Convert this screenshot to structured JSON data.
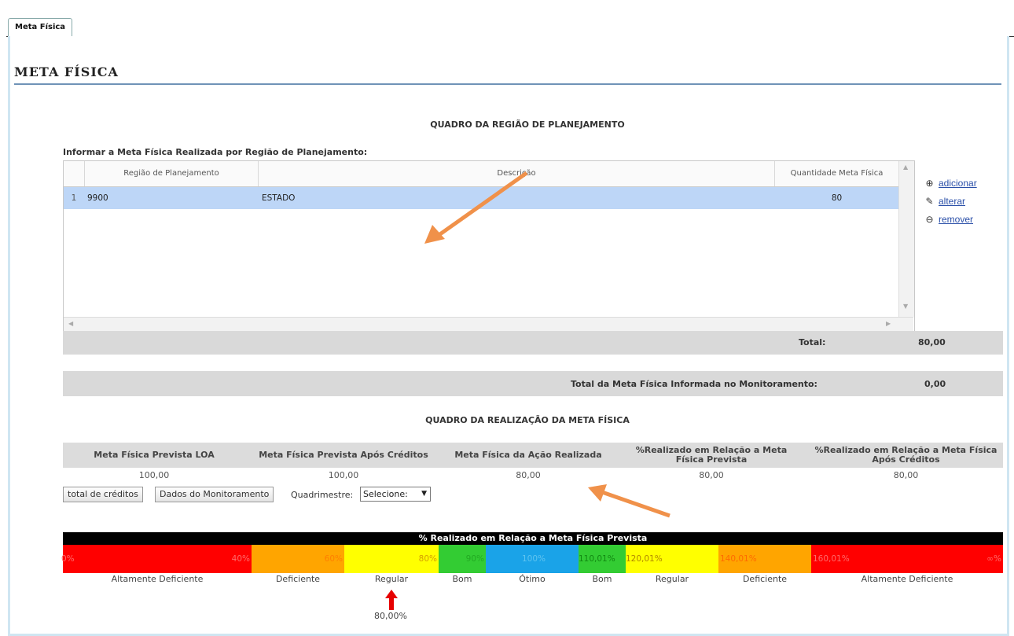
{
  "tab": {
    "label": "Meta Física"
  },
  "page_title": "META FÍSICA",
  "region_section": {
    "title": "QUADRO DA REGIÃO DE PLANEJAMENTO",
    "info_label": "Informar a Meta Física Realizada por Região de Planejamento:",
    "columns": [
      "Região de Planejamento",
      "Descrição",
      "Quantidade Meta Física"
    ],
    "rows": [
      {
        "num": "1",
        "region": "9900",
        "description": "ESTADO",
        "quantity": "80"
      }
    ],
    "total_label": "Total:",
    "total_value": "80,00",
    "actions": {
      "add": "adicionar",
      "edit": "alterar",
      "remove": "remover"
    }
  },
  "monitoring_total": {
    "label": "Total da Meta Física Informada no Monitoramento:",
    "value": "0,00"
  },
  "realization_section": {
    "title": "QUADRO DA REALIZAÇÃO DA META FÍSICA",
    "headers": [
      "Meta Física Prevista LOA",
      "Meta Física Prevista Após Créditos",
      "Meta Física da Ação Realizada",
      "%Realizado em Relação a Meta Física Prevista",
      "%Realizado em Relação a Meta Física Após Créditos"
    ],
    "values": [
      "100,00",
      "100,00",
      "80,00",
      "80,00",
      "80,00"
    ],
    "buttons": {
      "credits": "total de créditos",
      "monitoring": "Dados do Monitoramento"
    },
    "quadrimestre_label": "Quadrimestre:",
    "quadrimestre_value": "Selecione:"
  },
  "scale": {
    "title": "% Realizado em Relação a Meta Física Prevista",
    "segment_texts": [
      "0%",
      "40%",
      "60%",
      "80%",
      "90%",
      "100%",
      "110,01%",
      "120,01%",
      "140,01%",
      "160,01%",
      "∞%"
    ],
    "categories": [
      "Altamente Deficiente",
      "Deficiente",
      "Regular",
      "Bom",
      "Ótimo",
      "Bom",
      "Regular",
      "Deficiente",
      "Altamente Deficiente"
    ],
    "colors": {
      "red": "#ff0000",
      "orange": "#ffa500",
      "yellow": "#ffff00",
      "green": "#33cc33",
      "blue": "#1aa3e8"
    },
    "indicator_value": "80,00%"
  }
}
